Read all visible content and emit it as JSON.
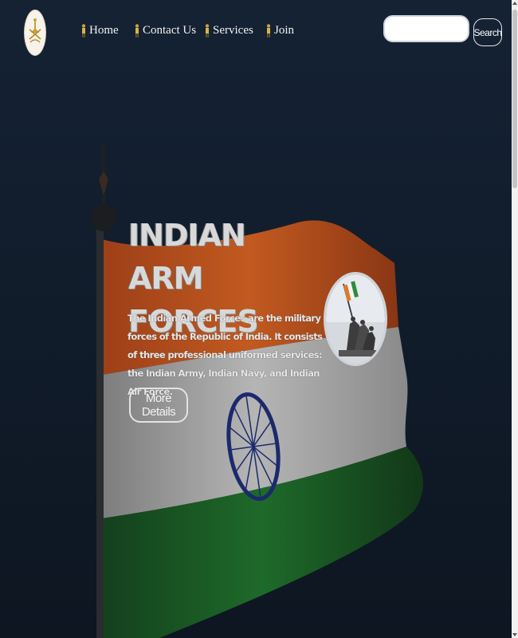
{
  "nav": {
    "items": [
      {
        "label": "Home"
      },
      {
        "label": "Contact Us"
      },
      {
        "label": "Services"
      },
      {
        "label": "Join"
      }
    ],
    "search_placeholder": "",
    "search_button": "Search"
  },
  "hero": {
    "title": "INDIAN ARM FORCES",
    "description": "The Indian Armed Forces are the military forces of the Republic of India. It consists of three professional uniformed services: the Indian Army, Indian Navy, and Indian Air Force.",
    "button_label": "More Details"
  },
  "colors": {
    "background": "#101a27",
    "saffron": "#b84f1d",
    "white": "#a9a9a9",
    "green": "#1a5a26",
    "chakra": "#1c2a6b",
    "text": "#f2f2f2"
  },
  "icons": {
    "logo": "army-emblem-icon",
    "nav": "soldier-icon",
    "flag": "indian-flag-image",
    "hero_image": "soldiers-raising-flag-image"
  }
}
